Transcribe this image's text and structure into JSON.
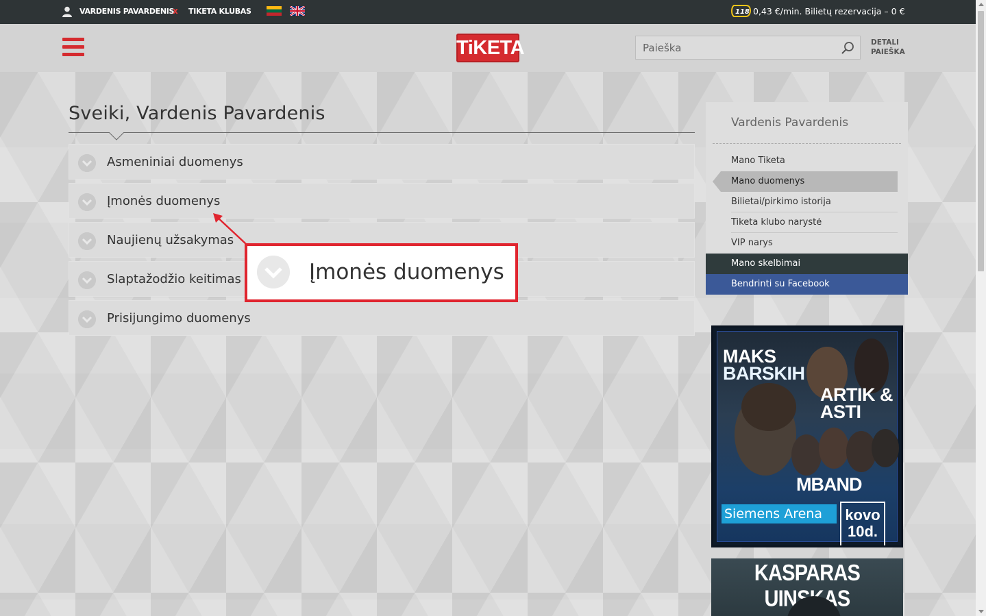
{
  "topbar": {
    "user_name": "VARDENIS PAVARDENIS",
    "logout": "x",
    "club": "TIKETA KLUBAS",
    "phone_badge": "118",
    "phone_text": "0,43 €/min. Bilietų rezervacija – 0 €"
  },
  "header": {
    "logo": "TiKETA",
    "search_placeholder": "Paieška",
    "detail_search_line1": "DETALI",
    "detail_search_line2": "PAIEŠKA"
  },
  "main": {
    "greeting": "Sveiki, Vardenis Pavardenis",
    "accordion": [
      {
        "label": "Asmeniniai duomenys"
      },
      {
        "label": "Įmonės duomenys"
      },
      {
        "label": "Naujienų užsakymas"
      },
      {
        "label": "Slaptažodžio keitimas"
      },
      {
        "label": "Prisijungimo duomenys"
      }
    ],
    "callout_label": "Įmonės duomenys"
  },
  "sidebar": {
    "title": "Vardenis Pavardenis",
    "items": [
      {
        "label": "Mano Tiketa"
      },
      {
        "label": "Mano duomenys"
      },
      {
        "label": "Bilietai/pirkimo istorija"
      },
      {
        "label": "Tiketa klubo narystė"
      },
      {
        "label": "VIP narys"
      },
      {
        "label": "Mano skelbimai"
      },
      {
        "label": "Bendrinti su Facebook"
      }
    ]
  },
  "ads": {
    "ad1": {
      "line1a": "MAKS",
      "line1b": "BARSKIH",
      "line2a": "ARTIK &",
      "line2b": "ASTI",
      "line3": "MBAND",
      "venue": "Siemens Arena",
      "date_a": "kovo",
      "date_b": "10d."
    },
    "ad2": {
      "title": "KASPARAS UINSKAS"
    }
  },
  "colors": {
    "brand_red": "#d52b2f",
    "topbar_bg": "#2e3436",
    "facebook": "#3b5998",
    "callout_border": "#e0252f"
  }
}
